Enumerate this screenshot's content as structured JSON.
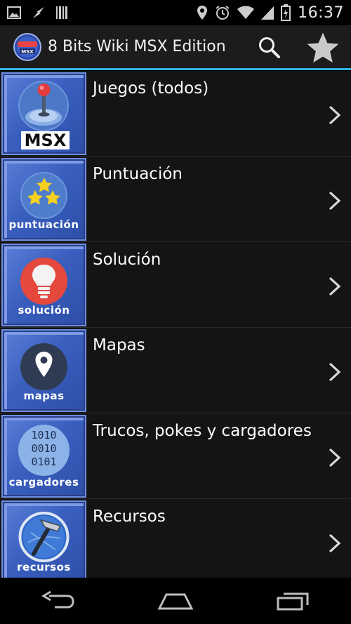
{
  "status_bar": {
    "time": "16:37",
    "left_icons": [
      "image-icon",
      "flash-icon",
      "barcode-icon"
    ],
    "right_icons": [
      "location-icon",
      "alarm-icon",
      "wifi-icon",
      "signal-icon",
      "battery-icon"
    ]
  },
  "action_bar": {
    "title": "8 Bits Wiki MSX Edition",
    "logo_text": "MSX",
    "search_icon": "search-icon",
    "star_icon": "star-icon",
    "accent_color": "#33b5e5"
  },
  "items": [
    {
      "title": "Juegos (todos)",
      "thumb_label": "MSX",
      "icon": "joystick-icon"
    },
    {
      "title": "Puntuación",
      "thumb_label": "puntuación",
      "icon": "stars-icon"
    },
    {
      "title": "Solución",
      "thumb_label": "solución",
      "icon": "lightbulb-icon"
    },
    {
      "title": "Mapas",
      "thumb_label": "mapas",
      "icon": "map-pin-icon"
    },
    {
      "title": "Trucos, pokes y cargadores",
      "thumb_label": "cargadores",
      "icon": "binary-icon",
      "binary_lines": [
        "1010",
        "0010",
        "0101"
      ]
    },
    {
      "title": "Recursos",
      "thumb_label": "recursos",
      "icon": "tools-icon"
    }
  ],
  "nav_bar": {
    "back_icon": "back-icon",
    "home_icon": "home-icon",
    "recents_icon": "recents-icon"
  }
}
